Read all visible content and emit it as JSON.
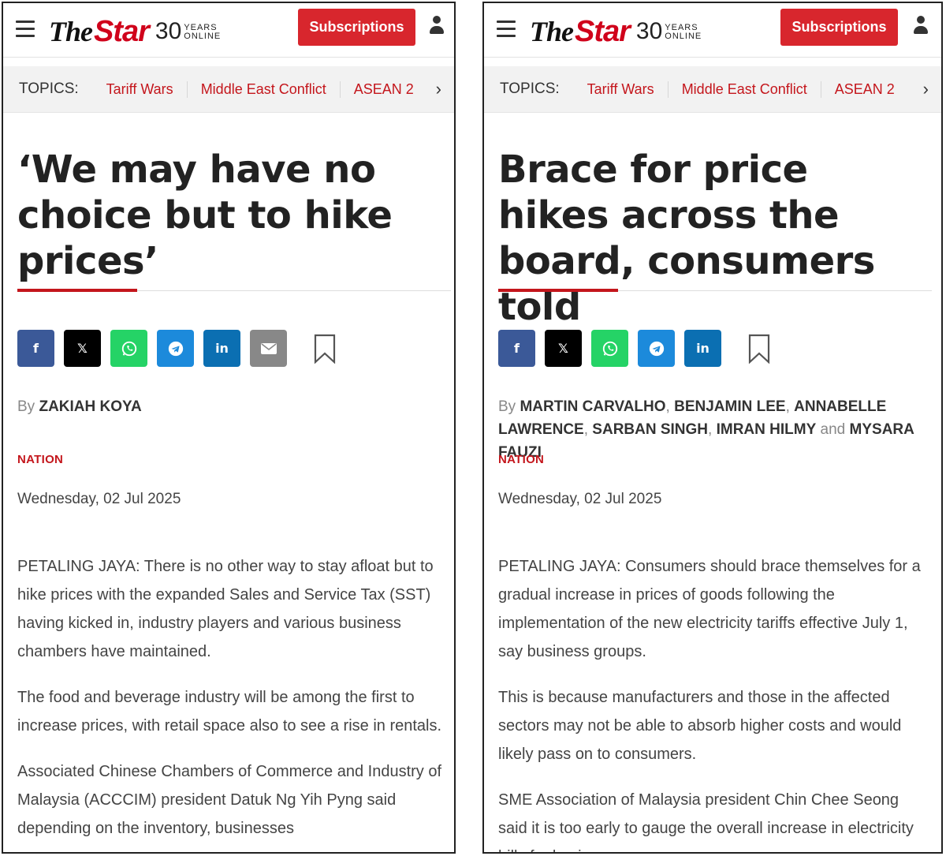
{
  "brand": {
    "the": "The",
    "star": "Star",
    "thirty": "30",
    "years": "YEARS",
    "online": "ONLINE"
  },
  "colors": {
    "accent_red": "#d8262d",
    "topic_red": "#c4161c",
    "text_dark": "#222222"
  },
  "icons": [
    "hamburger-menu-icon",
    "user-icon",
    "chevron-right-icon",
    "facebook-icon",
    "x-icon",
    "whatsapp-icon",
    "telegram-icon",
    "linkedin-icon",
    "email-icon",
    "bookmark-icon"
  ],
  "left": {
    "subscribe_label": "Subscriptions",
    "topics_label": "TOPICS:",
    "topics": [
      "Tariff Wars",
      "Middle East Conflict",
      "ASEAN 2"
    ],
    "headline": "‘We may have no choice but to hike prices’",
    "by": "By",
    "author": "ZAKIAH KOYA",
    "section": "NATION",
    "date": "Wednesday, 02 Jul 2025",
    "paragraphs": [
      "PETALING JAYA: There is no other way to stay afloat but to hike prices with the expanded Sales and Service Tax (SST) having kicked in, industry players and various business chambers have maintained.",
      "The food and beverage industry will be among the first to increase prices, with retail space also to see a rise in rentals.",
      "Associated Chinese Chambers of Commerce and Industry of Malaysia (ACCCIM) president Datuk Ng Yih Pyng said depending on the inventory, businesses"
    ]
  },
  "right": {
    "subscribe_label": "Subscriptions",
    "topics_label": "TOPICS:",
    "topics": [
      "Tariff Wars",
      "Middle East Conflict",
      "ASEAN 2"
    ],
    "headline": "Brace for price hikes across the board, consumers told",
    "by": "By",
    "authors": [
      "MARTIN CARVALHO",
      "BENJAMIN LEE",
      "ANNABELLE LAWRENCE",
      "SARBAN SINGH",
      "IMRAN HILMY",
      "MYSARA FAUZI"
    ],
    "comma": ",",
    "and": "and",
    "section": "NATION",
    "date": "Wednesday, 02 Jul 2025",
    "paragraphs": [
      "PETALING JAYA: Consumers should brace themselves for a gradual increase in prices of goods following the implementation of the new electricity tariffs effective July 1, say business groups.",
      "This is because manufacturers and those in the affected sectors may not be able to absorb higher costs and would likely pass on to consumers.",
      "SME Association of Malaysia president Chin Chee Seong said it is too early to gauge the overall increase in electricity bills for businesses"
    ]
  }
}
